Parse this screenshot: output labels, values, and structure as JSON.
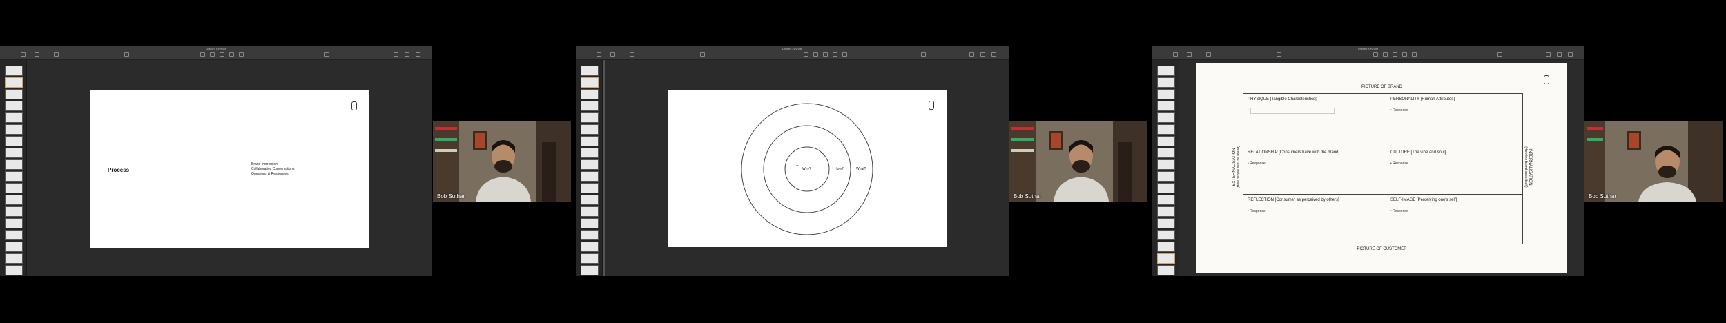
{
  "windows": [
    {
      "title": "Untitled Keynote"
    },
    {
      "title": "Untitled Keynote"
    },
    {
      "title": "Untitled Keynote"
    }
  ],
  "toolbar_labels": [
    "View",
    "Zoom",
    "Add Slide",
    "Play",
    "Table",
    "Chart",
    "Text",
    "Shape",
    "Media",
    "Comment",
    "Collaborate",
    "Format",
    "Animate",
    "Document"
  ],
  "slide1": {
    "title": "Process",
    "items": [
      "Brand Immersion",
      "Collaborative Conversations",
      "Questions & Responses"
    ]
  },
  "slide2": {
    "rings": [
      "Why?",
      "How?",
      "What?"
    ]
  },
  "slide3": {
    "top_label": "PICTURE OF BRAND",
    "bottom_label": "PICTURE OF CUSTOMER",
    "left_label": "EXTERNALISATION",
    "left_sub": "(How people see the brand)",
    "right_label": "INTERNALISATION",
    "right_sub": "(How the brand sees itself)",
    "cells": [
      {
        "head": "PHYSIQUE [Tangible Characteristics]",
        "resp": "•"
      },
      {
        "head": "PERSONALITY [Human Attributes]",
        "resp": "• Response"
      },
      {
        "head": "RELATIONSHIP [Consumers have with the brand]",
        "resp": "• Response"
      },
      {
        "head": "CULTURE [The vibe and soul]",
        "resp": "• Response"
      },
      {
        "head": "REFLECTION [Consumer as perceived by others]",
        "resp": "• Response"
      },
      {
        "head": "SELF-IMAGE [Perceiving one's self]",
        "resp": "• Response"
      }
    ]
  },
  "participant": {
    "name": "Bob Suthar"
  },
  "colors": {
    "bg": "#000000",
    "window": "#2b2b2b",
    "toolbar": "#3a3a3a",
    "slide": "#ffffff",
    "slide3": "#fbfaf6"
  }
}
